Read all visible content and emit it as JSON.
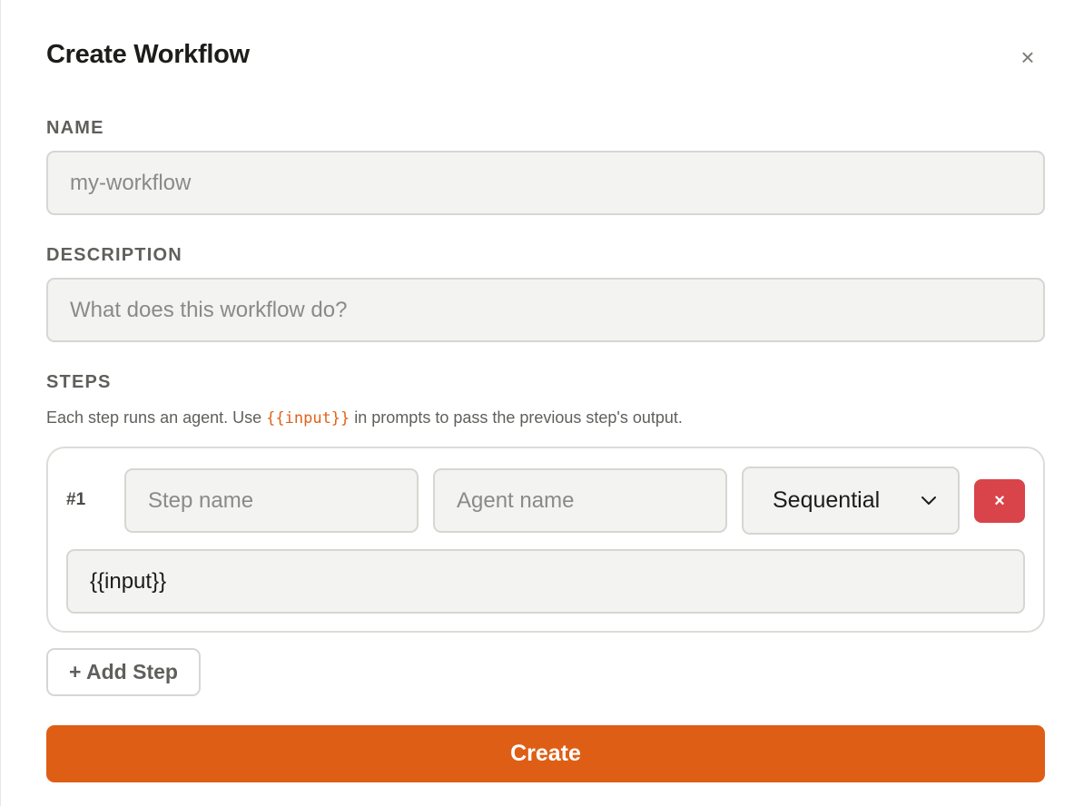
{
  "dialog": {
    "title": "Create Workflow",
    "close_icon": "close-icon",
    "close_glyph": "×"
  },
  "name_field": {
    "label": "NAME",
    "value": "",
    "placeholder": "my-workflow"
  },
  "description_field": {
    "label": "DESCRIPTION",
    "value": "",
    "placeholder": "What does this workflow do?"
  },
  "steps": {
    "label": "STEPS",
    "hint_before": "Each step runs an agent. Use ",
    "hint_code": "{{input}}",
    "hint_after": " in prompts to pass the previous step's output.",
    "items": [
      {
        "number": "#1",
        "step_name": {
          "value": "",
          "placeholder": "Step name"
        },
        "agent_name": {
          "value": "",
          "placeholder": "Agent name"
        },
        "mode": {
          "selected": "Sequential",
          "icon": "chevron-down-icon"
        },
        "remove_glyph": "×",
        "remove_icon": "close-icon",
        "prompt": {
          "value": "{{input}}"
        }
      }
    ],
    "add_label": "+ Add Step"
  },
  "actions": {
    "create_label": "Create"
  },
  "colors": {
    "accent": "#df5e16",
    "danger": "#d9434a",
    "code": "#e0621a",
    "field_bg": "#f3f3f1",
    "border": "#d6d6d2"
  }
}
